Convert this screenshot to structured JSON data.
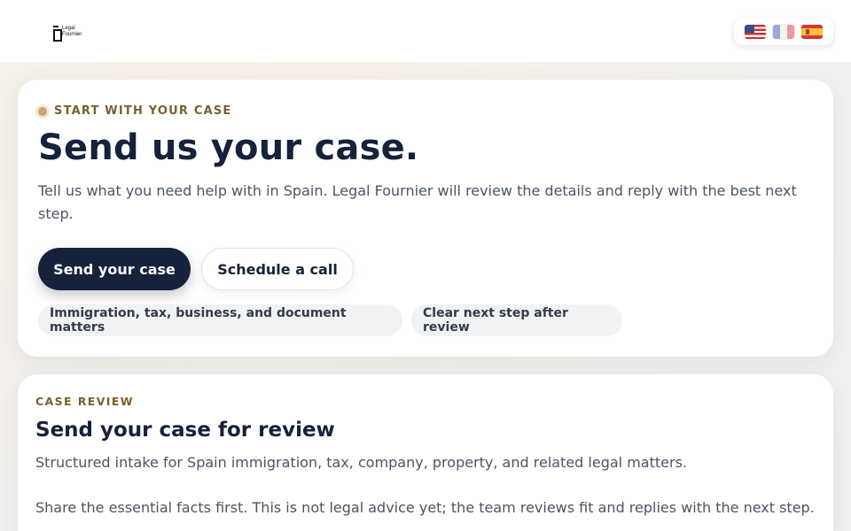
{
  "header": {
    "logo_line1": "Legal",
    "logo_line2": "Fournier",
    "languages": [
      {
        "code": "en",
        "icon": "us-flag-icon"
      },
      {
        "code": "fr",
        "icon": "france-flag-icon"
      },
      {
        "code": "es",
        "icon": "spain-flag-icon"
      }
    ]
  },
  "hero": {
    "eyebrow": "START WITH YOUR CASE",
    "title": "Send us your case.",
    "description": "Tell us what you need help with in Spain. Legal Fournier will review the details and reply with the best next step.",
    "primary_button": "Send your case",
    "secondary_button": "Schedule a call",
    "chips": [
      "Immigration, tax, business, and document matters",
      "Clear next step after review"
    ]
  },
  "review": {
    "eyebrow": "CASE REVIEW",
    "title": "Send your case for review",
    "description": "Structured intake for Spain immigration, tax, company, property, and related legal matters.",
    "note": "Share the essential facts first. This is not legal advice yet; the team reviews fit and replies with the next step."
  },
  "colors": {
    "navy": "#16223b",
    "gold": "#7a5f2e",
    "accent_dot": "#caa36d"
  }
}
